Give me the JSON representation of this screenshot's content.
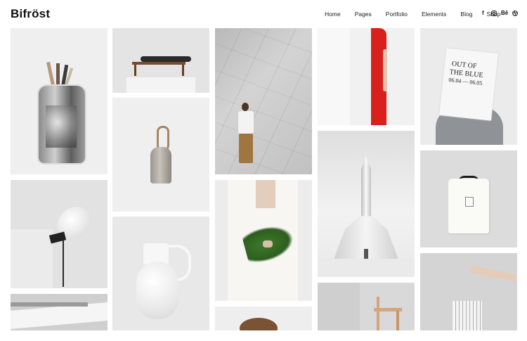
{
  "site": {
    "logo": "Bifröst"
  },
  "nav": {
    "items": [
      "Home",
      "Pages",
      "Portfolio",
      "Elements",
      "Blog",
      "Shop"
    ]
  },
  "social": [
    {
      "icon": "facebook-icon",
      "glyph": "f"
    },
    {
      "icon": "instagram-icon",
      "glyph": ""
    },
    {
      "icon": "behance-icon",
      "glyph": "Bē"
    },
    {
      "icon": "dribbble-icon",
      "glyph": ""
    }
  ],
  "bag_print": {
    "line1": "OUT OF",
    "line2": "THE BLUE",
    "dates": "06.04 — 06.05"
  },
  "colors": {
    "accent_dress": "#d8201c",
    "plant": "#3f7a2c",
    "chair": "#d4a57a",
    "trousers": "#a0763f"
  }
}
